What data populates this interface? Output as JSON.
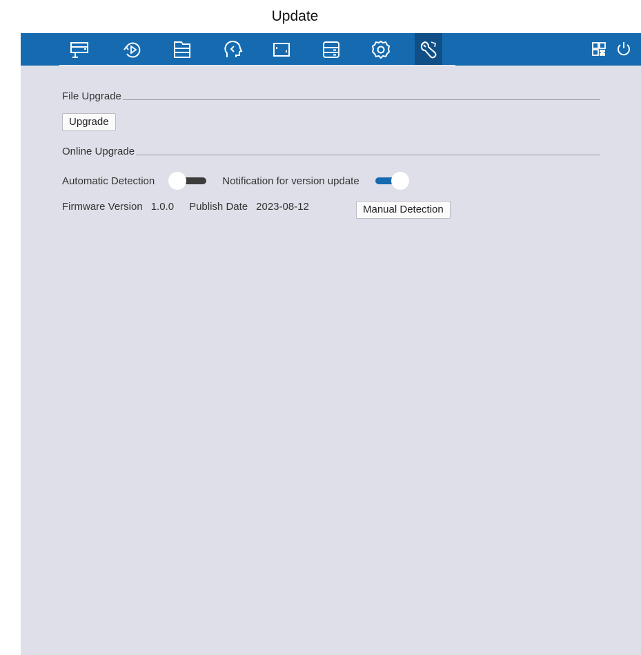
{
  "page": {
    "title": "Update"
  },
  "toolbar": {
    "icons": [
      {
        "name": "live-view-icon"
      },
      {
        "name": "playback-icon"
      },
      {
        "name": "file-icon"
      },
      {
        "name": "backup-icon"
      },
      {
        "name": "channel-icon"
      },
      {
        "name": "storage-icon"
      },
      {
        "name": "settings-icon"
      },
      {
        "name": "maintenance-icon",
        "active": true
      }
    ],
    "right_icons": [
      "qr-code-icon",
      "power-icon"
    ],
    "bg_color": "#166bb0",
    "active_color": "#0f4f86"
  },
  "file_upgrade": {
    "heading": "File Upgrade",
    "upgrade_button": "Upgrade"
  },
  "online_upgrade": {
    "heading": "Online Upgrade",
    "auto_detection_label": "Automatic Detection",
    "auto_detection_on": false,
    "notification_label": "Notification for version update",
    "notification_on": true,
    "firmware_label": "Firmware Version",
    "firmware_value": "1.0.0",
    "publish_label": "Publish Date",
    "publish_value": "2023-08-12",
    "manual_detection_button": "Manual Detection"
  }
}
